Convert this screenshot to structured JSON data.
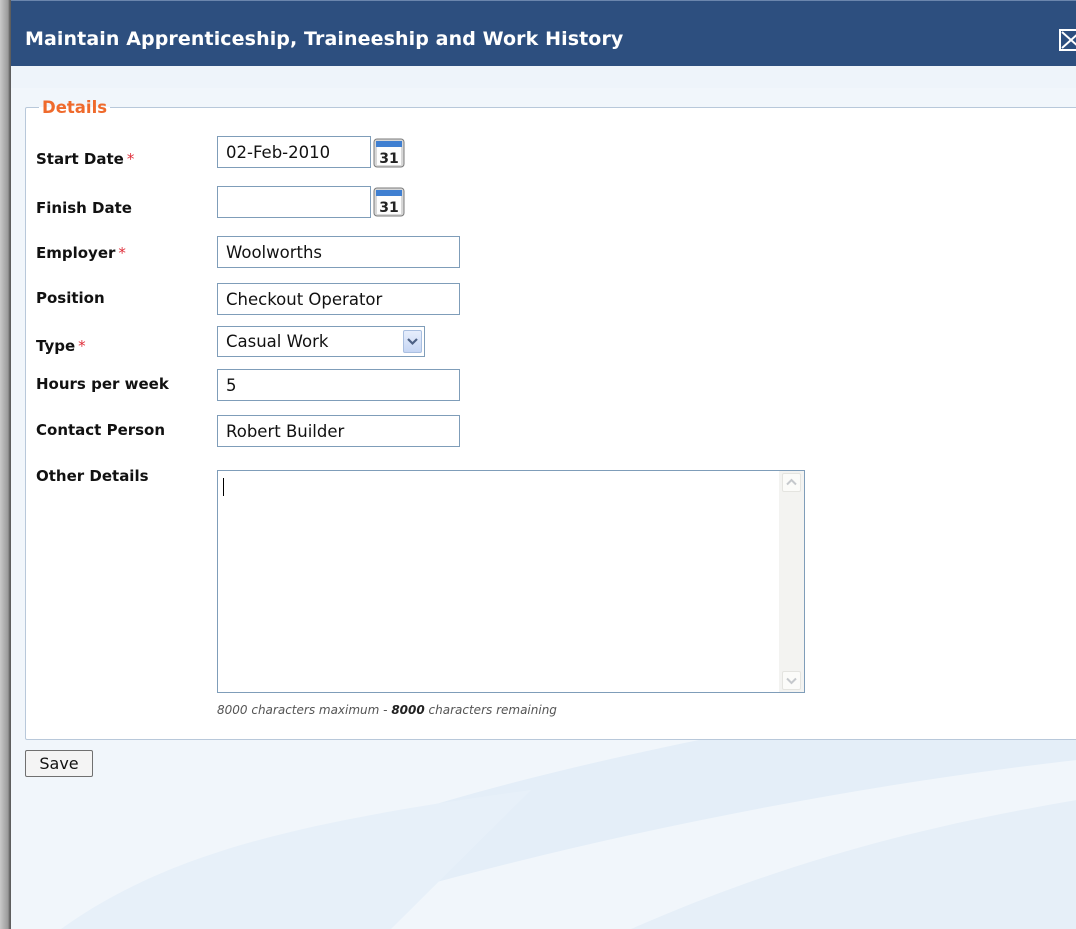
{
  "dialog": {
    "title": "Maintain Apprenticeship, Traineeship and Work History",
    "close_icon": "close-icon"
  },
  "details": {
    "legend": "Details",
    "required_marker": "*",
    "fields": {
      "start_date": {
        "label": "Start Date",
        "value": "02-Feb-2010"
      },
      "finish_date": {
        "label": "Finish Date",
        "value": ""
      },
      "employer": {
        "label": "Employer",
        "value": "Woolworths"
      },
      "position": {
        "label": "Position",
        "value": "Checkout Operator"
      },
      "type": {
        "label": "Type",
        "selected": "Casual Work"
      },
      "hours_per_week": {
        "label": "Hours per week",
        "value": "5"
      },
      "contact_person": {
        "label": "Contact Person",
        "value": "Robert Builder"
      },
      "other_details": {
        "label": "Other Details",
        "value": ""
      }
    },
    "calendar_icon_text": "31",
    "char_limit": {
      "max_text": "8000 characters maximum - ",
      "remaining_value": "8000",
      "remaining_text": " characters remaining"
    }
  },
  "actions": {
    "save_label": "Save"
  },
  "colors": {
    "titlebar": "#2d4f7f",
    "legend": "#ef6a2c",
    "required": "#e0303c",
    "background": "#f1f6fb"
  }
}
